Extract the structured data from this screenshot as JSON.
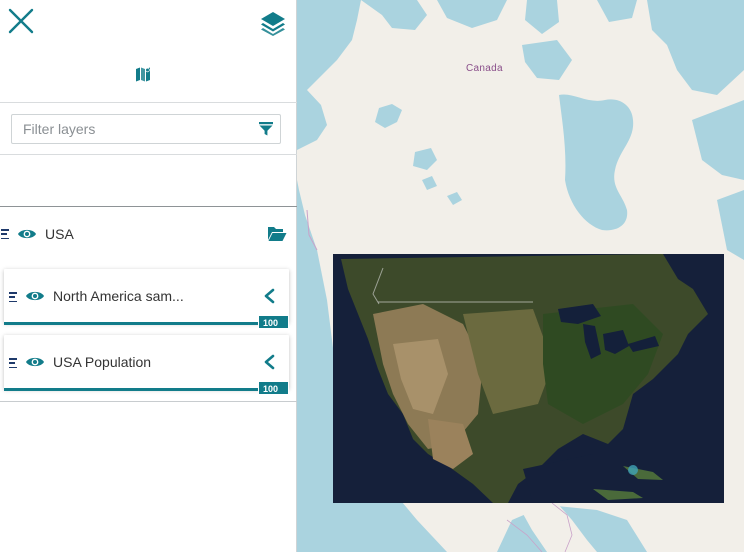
{
  "panel": {
    "filter": {
      "placeholder": "Filter layers"
    },
    "group": {
      "title": "USA"
    },
    "layers": [
      {
        "name": "North America sam...",
        "opacity": "100 %"
      },
      {
        "name": "USA Population",
        "opacity": "100 %"
      }
    ]
  },
  "map": {
    "country_label": "Canada"
  },
  "icons": {
    "close": "close-icon",
    "layers": "layers-icon",
    "catalog": "map-catalog-icon",
    "filter": "filter-icon",
    "visibility": "eye-icon",
    "folder": "folder-open-icon",
    "expand": "chevron-left-icon",
    "drag": "drag-handle-icon"
  },
  "colors": {
    "accent": "#127c8a",
    "water": "#aad3df",
    "land": "#f2efe9",
    "border_text": "#8a4f8a"
  }
}
